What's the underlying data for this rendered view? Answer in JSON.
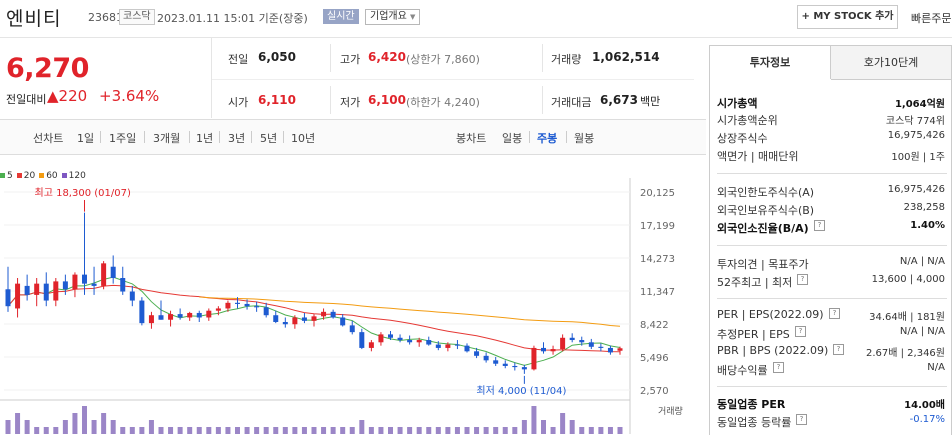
{
  "header": {
    "name": "엔비티",
    "code": "236810",
    "market_tag": "코스닥",
    "datetime": "2023.01.11 15:01 기준(장중)",
    "live": "실시간",
    "corp_info": "기업개요",
    "my_stock": "+ MY STOCK 추가",
    "quick_order": "빠른주문"
  },
  "quote": {
    "price": "6,270",
    "change_label": "전일대비",
    "change": "▲220",
    "change_pct": "+3.64%",
    "prev_close_label": "전일",
    "prev_close": "6,050",
    "high_label": "고가",
    "high": "6,420",
    "upper_limit": "(상한가 7,860)",
    "volume_label": "거래량",
    "volume": "1,062,514",
    "open_label": "시가",
    "open": "6,110",
    "low_label": "저가",
    "low": "6,100",
    "lower_limit": "(하한가 4,240)",
    "value_label": "거래대금",
    "value": "6,673",
    "value_unit": "백만"
  },
  "periods": {
    "line_label": "선차트",
    "items": [
      "1일",
      "1주일",
      "3개월",
      "1년",
      "3년",
      "5년",
      "10년"
    ],
    "candle_label": "봉차트",
    "candle_items": [
      "일봉",
      "주봉",
      "월봉"
    ],
    "active_candle": "주봉"
  },
  "right": {
    "tab1": "투자정보",
    "tab2": "호가10단계",
    "rows": [
      {
        "k": "시가총액",
        "v": "1,064억원",
        "bold": true
      },
      {
        "k": "시가총액순위",
        "v": "코스닥 774위"
      },
      {
        "k": "상장주식수",
        "v": "16,975,426"
      },
      {
        "k": "액면가 | 매매단위",
        "v": "100원 | 1주"
      },
      {
        "k": "외국인한도주식수(A)",
        "v": "16,975,426"
      },
      {
        "k": "외국인보유주식수(B)",
        "v": "238,258"
      },
      {
        "k": "외국인소진율(B/A)",
        "v": "1.40%",
        "bold": true,
        "q": true
      },
      {
        "k": "투자의견 | 목표주가",
        "v": "N/A | N/A"
      },
      {
        "k": "52주최고 | 최저",
        "v": "13,600 | 4,000",
        "q": true
      },
      {
        "k": "PER | EPS(2022.09)",
        "v": "34.64배 | 181원",
        "q": true
      },
      {
        "k": "추정PER | EPS",
        "v": "N/A | N/A",
        "q": true
      },
      {
        "k": "PBR | BPS (2022.09)",
        "v": "2.67배 | 2,346원",
        "q": true
      },
      {
        "k": "배당수익률",
        "v": "N/A",
        "q": true
      },
      {
        "k": "동일업종 PER",
        "v": "14.00배",
        "bold": true
      },
      {
        "k": "동일업종 등락률",
        "v": "-0.17%",
        "q": true,
        "blue": true
      }
    ]
  },
  "chart_data": {
    "type": "candlestick",
    "legend": [
      "5",
      "20",
      "60",
      "120"
    ],
    "legend_colors": [
      "#4caf50",
      "#e53935",
      "#f39c12",
      "#7e57c2"
    ],
    "y_ticks": [
      20125,
      17199,
      14273,
      11347,
      8422,
      5496,
      2570
    ],
    "ylim": [
      2570,
      20125
    ],
    "high_note": "최고 18,300 (01/07)",
    "low_note": "최저 4,000 (11/04)",
    "volume_label": "거래량",
    "candles": [
      [
        11500,
        13500,
        9500,
        10000
      ],
      [
        9800,
        12500,
        9000,
        12000
      ],
      [
        11800,
        12800,
        10500,
        11000
      ],
      [
        11000,
        12500,
        10000,
        12000
      ],
      [
        12000,
        13000,
        10000,
        10500
      ],
      [
        10500,
        12500,
        10000,
        12200
      ],
      [
        12200,
        12800,
        11000,
        11500
      ],
      [
        11500,
        13000,
        10800,
        12800
      ],
      [
        12800,
        18300,
        11000,
        12000
      ],
      [
        12000,
        13500,
        11000,
        11800
      ],
      [
        11800,
        14000,
        11500,
        13800
      ],
      [
        13500,
        14500,
        12000,
        12500
      ],
      [
        12500,
        13500,
        11000,
        11300
      ],
      [
        11300,
        11800,
        10000,
        10500
      ],
      [
        10500,
        10800,
        8300,
        8500
      ],
      [
        8500,
        9500,
        8000,
        9200
      ],
      [
        9200,
        10500,
        8800,
        8800
      ],
      [
        8800,
        9600,
        8200,
        9300
      ],
      [
        9300,
        9800,
        8800,
        9000
      ],
      [
        9000,
        9500,
        8700,
        9400
      ],
      [
        9400,
        9600,
        8600,
        9000
      ],
      [
        9000,
        9800,
        8700,
        9600
      ],
      [
        9600,
        10000,
        9200,
        9800
      ],
      [
        9800,
        10500,
        9500,
        10300
      ],
      [
        10300,
        10800,
        9800,
        10200
      ],
      [
        10200,
        10600,
        9700,
        10000
      ],
      [
        10000,
        10400,
        9500,
        9900
      ],
      [
        9900,
        10300,
        9000,
        9200
      ],
      [
        9200,
        9600,
        8500,
        8600
      ],
      [
        8600,
        9000,
        8100,
        8400
      ],
      [
        8400,
        9200,
        8000,
        9000
      ],
      [
        9000,
        9400,
        8500,
        8700
      ],
      [
        8700,
        9300,
        8200,
        9100
      ],
      [
        9100,
        9800,
        8800,
        9500
      ],
      [
        9500,
        9700,
        8900,
        9000
      ],
      [
        9000,
        9300,
        8200,
        8300
      ],
      [
        8300,
        8700,
        7500,
        7700
      ],
      [
        7700,
        8000,
        6200,
        6300
      ],
      [
        6300,
        7000,
        6000,
        6800
      ],
      [
        6800,
        7700,
        6500,
        7500
      ],
      [
        7500,
        7800,
        7000,
        7200
      ],
      [
        7200,
        7500,
        6800,
        7000
      ],
      [
        7000,
        7400,
        6600,
        6800
      ],
      [
        6800,
        7200,
        6400,
        7000
      ],
      [
        7000,
        7300,
        6500,
        6600
      ],
      [
        6600,
        6900,
        6100,
        6300
      ],
      [
        6300,
        6800,
        6000,
        6600
      ],
      [
        6600,
        7000,
        6200,
        6500
      ],
      [
        6500,
        6700,
        5900,
        6000
      ],
      [
        6000,
        6300,
        5400,
        5600
      ],
      [
        5600,
        5900,
        5000,
        5200
      ],
      [
        5200,
        5500,
        4700,
        4900
      ],
      [
        4900,
        5200,
        4500,
        4700
      ],
      [
        4700,
        5000,
        4300,
        4600
      ],
      [
        4600,
        4800,
        4000,
        4400
      ],
      [
        4400,
        6500,
        4300,
        6300
      ],
      [
        6300,
        6800,
        5800,
        6000
      ],
      [
        6000,
        6500,
        5700,
        6200
      ],
      [
        6200,
        7500,
        6000,
        7200
      ],
      [
        7200,
        7600,
        6800,
        7000
      ],
      [
        7000,
        7300,
        6500,
        6800
      ],
      [
        6800,
        7100,
        6200,
        6400
      ],
      [
        6400,
        6700,
        6000,
        6300
      ],
      [
        6300,
        6500,
        5700,
        5900
      ],
      [
        6050,
        6420,
        5700,
        6270
      ]
    ],
    "volumes": [
      2,
      3,
      2,
      1,
      1,
      1,
      2,
      3,
      4,
      2,
      3,
      2,
      1,
      1,
      1,
      2,
      1,
      1,
      1,
      1,
      1,
      1,
      1,
      1,
      1,
      1,
      1,
      1,
      1,
      1,
      1,
      1,
      1,
      1,
      1,
      1,
      1,
      2,
      1,
      1,
      1,
      1,
      1,
      1,
      1,
      1,
      1,
      1,
      1,
      1,
      1,
      1,
      1,
      1,
      2,
      4,
      2,
      1,
      3,
      2,
      1,
      1,
      1,
      1,
      1
    ]
  }
}
